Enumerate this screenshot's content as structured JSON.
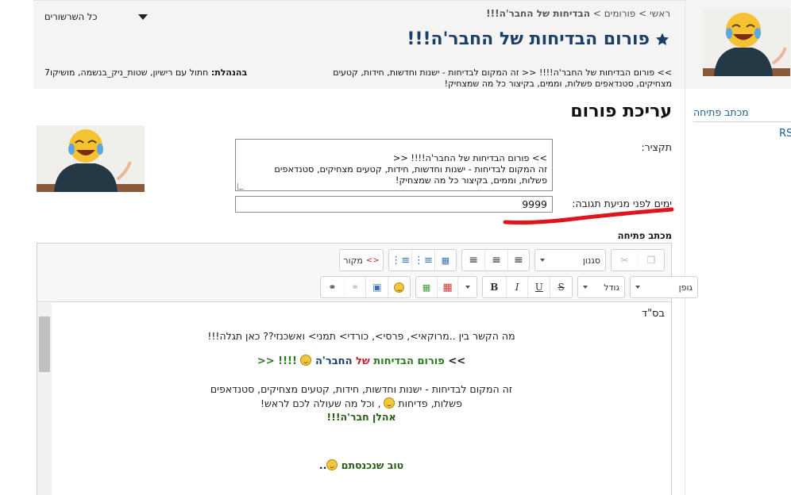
{
  "header": {
    "breadcrumb_home": "ראשי",
    "breadcrumb_sep1": ">",
    "breadcrumb_forums": "פורומים",
    "breadcrumb_sep2": ">",
    "breadcrumb_current": "הבדיחות של החבר'ה!!!",
    "forum_title": "פורום הבדיחות של החבר'ה!!!",
    "forum_description": ">> פורום הבדיחות של החבר'ה!!!! << זה המקום לבדיחות - ישנות וחדשות, חידות, קטעים מצחיקים, סטנדאפים פשלות, וממים, בקיצור כל מה שמצחיק!",
    "managers_label": "בהנהלת:",
    "managers_value": "חתול עם רישיון, שטות_ניק_בנשמה, מושיקו7",
    "all_roots_label": "כל השרשורים"
  },
  "right_column": {
    "link_opening": "מכתב פתיחה",
    "link_rss": "RSS"
  },
  "form": {
    "section_title": "עריכת פורום",
    "summary_label": "תקציר:",
    "summary_value": ">> פורום הבדיחות של החבר'ה!!!! <<\nזה המקום לבדיחות - ישנות וחדשות, חידות, קטעים מצחיקים, סטנדאפים\nפשלות, וממים, בקיצור כל מה שמצחיק!",
    "days_label": "ימים לפני מניעת תגובה:",
    "days_value": "9999",
    "opening_letter_label": "מכתב פתיחה"
  },
  "toolbar": {
    "source_label": "מקור",
    "style_combo": "סגנון",
    "font_combo": "גופן",
    "size_combo": "גודל",
    "bold": "B",
    "italic": "I",
    "underline": "U",
    "strike": "S"
  },
  "editor_content": {
    "line_bsd": "בס\"ד",
    "line_connection": "מה הקשר בין ..מרוקאי>, פרסי>, כורדי> תמני> ואשכנזי??  כאן תגלה!!!",
    "title_open": ">>",
    "title_forum": "פורום",
    "title_jokes": "הבדיחות",
    "title_of": "של",
    "title_guys": "החבר'ה",
    "title_close": "!!!! <<",
    "desc_1": "זה המקום לבדיחות - ישנות וחדשות, חידות, קטעים מצחיקים, סטנדאפים",
    "desc_2a": "פשלות, פדיחות",
    "desc_2b": ", וכל מה שעולה לכם לראש!",
    "welcome": "אהלן חבר'ה!!!",
    "good_to_have": "טוב שנכנסתם",
    "dots": ".."
  },
  "colors": {
    "title_navy": "#1c3f66",
    "link_blue": "#1a5d94",
    "accent_red": "#c0282d",
    "accent_green": "#2a7a1f"
  }
}
